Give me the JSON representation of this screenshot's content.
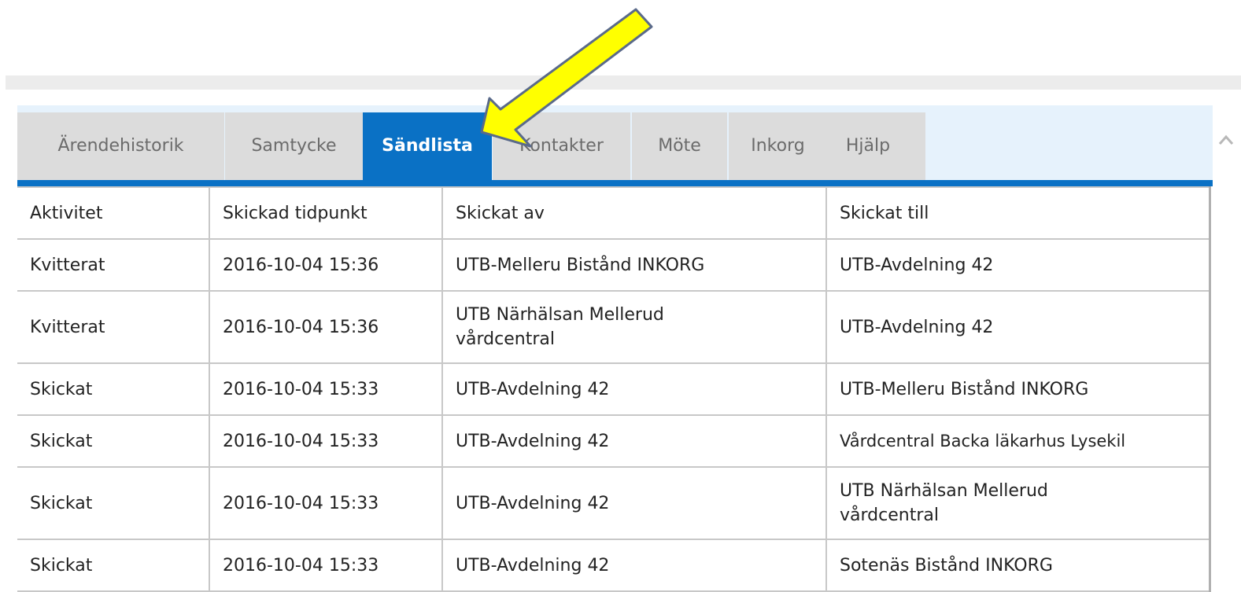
{
  "tabs": [
    {
      "label": "Ärendehistorik",
      "active": false
    },
    {
      "label": "Samtycke",
      "active": false
    },
    {
      "label": "Sändlista",
      "active": true
    },
    {
      "label": "Kontakter",
      "active": false
    },
    {
      "label": "Möte",
      "active": false
    },
    {
      "label": "Inkorg",
      "active": false
    },
    {
      "label": "Hjälp",
      "active": false
    }
  ],
  "table": {
    "headers": [
      "Aktivitet",
      "Skickad tidpunkt",
      "Skickat av",
      "Skickat till"
    ],
    "rows": [
      [
        "Kvitterat",
        "2016-10-04 15:36",
        "UTB-Melleru Bistånd INKORG",
        "UTB-Avdelning 42"
      ],
      [
        "Kvitterat",
        "2016-10-04 15:36",
        "UTB Närhälsan Mellerud vårdcentral",
        "UTB-Avdelning 42"
      ],
      [
        "Skickat",
        "2016-10-04 15:33",
        "UTB-Avdelning 42",
        "UTB-Melleru Bistånd INKORG"
      ],
      [
        "Skickat",
        "2016-10-04 15:33",
        "UTB-Avdelning 42",
        "Vårdcentral Backa läkarhus Lysekil"
      ],
      [
        "Skickat",
        "2016-10-04 15:33",
        "UTB-Avdelning 42",
        "UTB Närhälsan Mellerud vårdcentral"
      ],
      [
        "Skickat",
        "2016-10-04 15:33",
        "UTB-Avdelning 42",
        "Sotenäs Bistånd INKORG"
      ]
    ]
  },
  "colors": {
    "accent": "#0a71c5",
    "tab_bar_bg": "#e6f2fc",
    "tab_bg": "#dcdcdc",
    "annotation_arrow_fill": "#ffff00"
  },
  "icons": {
    "scroll_up": "chevron-up-icon",
    "annotation": "annotation-arrow-icon"
  }
}
